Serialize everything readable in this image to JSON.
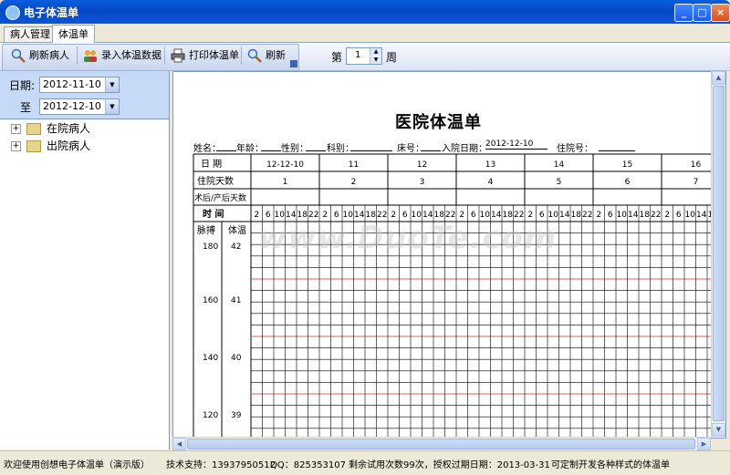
{
  "window": {
    "title": "电子体温单"
  },
  "tabs": [
    "病人管理",
    "体温单"
  ],
  "toolbar": {
    "refresh_patient": "刷新病人",
    "enter_data": "录入体温数据",
    "print_sheet": "打印体温单",
    "refresh": "刷新",
    "week_prefix": "第",
    "week_value": "1",
    "week_suffix": "周"
  },
  "filter": {
    "date_label": "日期:",
    "date_from": "2012-11-10",
    "to_label": "至",
    "date_to": "2012-12-10"
  },
  "tree": [
    "在院病人",
    "出院病人"
  ],
  "sheet": {
    "title": "医院体温单",
    "info": {
      "name": "姓名：",
      "age": "年龄：",
      "sex": "性别：",
      "dept": "科别：",
      "bed": "床号：",
      "admit_label": "入院日期：",
      "admit_date": "2012-12-10",
      "hospital_no": "住院号："
    },
    "row_date": "日 期",
    "row_days": "住院天数",
    "row_postop": "术后/产后天数",
    "row_time": "时 间",
    "pulse_label": "脉搏",
    "temp_label": "体温",
    "dates": [
      "12-12-10",
      "11",
      "12",
      "13",
      "14",
      "15",
      "16"
    ],
    "days": [
      "1",
      "2",
      "3",
      "4",
      "5",
      "6",
      "7"
    ],
    "hours": [
      "2",
      "6",
      "10",
      "14",
      "18",
      "22"
    ],
    "pulse_scale": [
      "180",
      "160",
      "140",
      "120"
    ],
    "temp_scale": [
      "42",
      "41",
      "40",
      "39"
    ]
  },
  "watermark": "www.DuoTe.com",
  "status": {
    "welcome": "欢迎使用创想电子体温单（演示版）",
    "support": "技术支持：13937950512",
    "qq": "QQ：825353107",
    "trial": "剩余试用次数99次，授权过期日期：2013-03-31",
    "custom": "可定制开发各种样式的体温单"
  },
  "colors": {
    "titlebar": "#0648c7",
    "grid_red": "#e06060",
    "panel_blue": "#c6d9f7"
  }
}
